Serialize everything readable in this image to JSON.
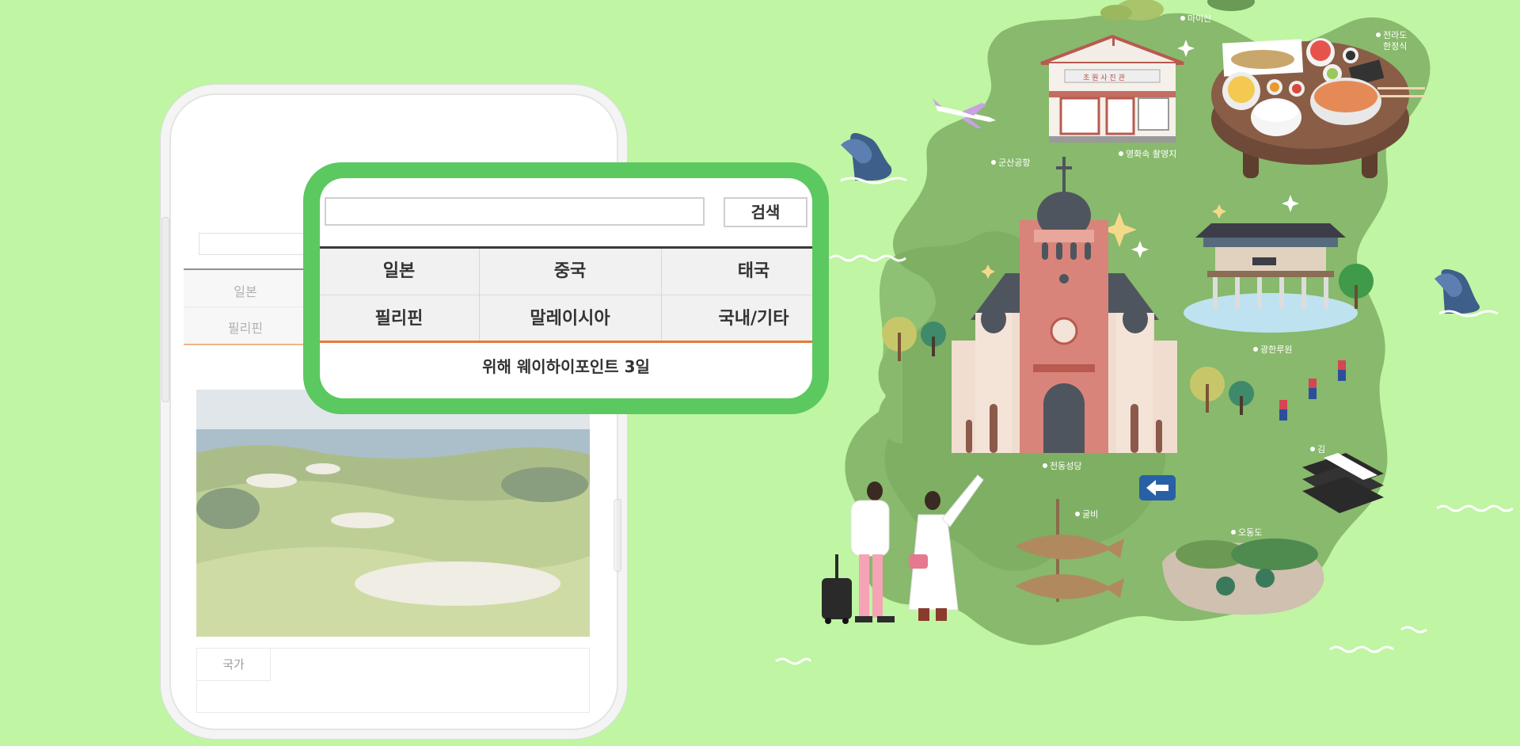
{
  "background_color": "#bff5a3",
  "phone_screen": {
    "categories": [
      "일본",
      "필리핀"
    ],
    "info_table": {
      "label": "국가"
    }
  },
  "zoom_card": {
    "search_input": {
      "value": "",
      "placeholder": ""
    },
    "search_button": "검색",
    "categories": [
      [
        "일본",
        "중국",
        "태국"
      ],
      [
        "필리핀",
        "말레이시아",
        "국내/기타"
      ]
    ],
    "footer_text": "위해 웨이하이포인트 3일",
    "colors": {
      "frame": "#5cc860",
      "top_rule": "#3a3a3a",
      "bottom_rule": "#e9773a"
    }
  },
  "map_labels": {
    "maisan": "마이산",
    "jeolla_hanjeongsik": [
      "전라도",
      "한정식"
    ],
    "gunsan_airport": "군산공항",
    "film_location": "영화속 촬영지",
    "photo_studio_sign": "초 원 사 진 관",
    "gwanghallu": "광한루원",
    "jeondong_cathedral": "전동성당",
    "gim": "김",
    "gulbi": "굴비",
    "odongdo": "오동도"
  },
  "icons": [
    "airplane-icon",
    "wave-icon",
    "sparkle-icon",
    "direction-sign-icon",
    "luggage-icon"
  ]
}
